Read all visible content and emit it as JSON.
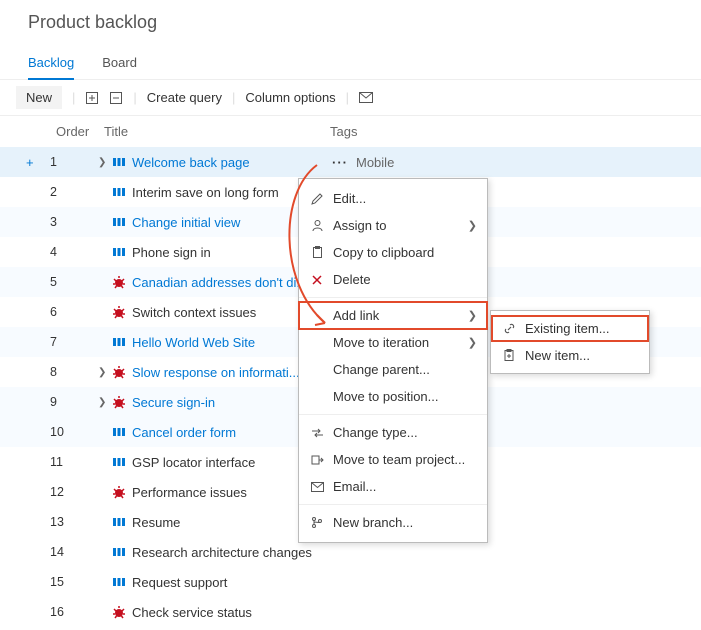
{
  "page_title": "Product backlog",
  "tabs": {
    "backlog": "Backlog",
    "board": "Board"
  },
  "toolbar": {
    "new": "New",
    "create_query": "Create query",
    "column_options": "Column options"
  },
  "columns": {
    "order": "Order",
    "title": "Title",
    "tags": "Tags"
  },
  "items": [
    {
      "order": 1,
      "type": "pbi",
      "title": "Welcome back page",
      "link": true,
      "tag": "Mobile",
      "expand": true,
      "selected": true,
      "more": true
    },
    {
      "order": 2,
      "type": "pbi",
      "title": "Interim save on long form"
    },
    {
      "order": 3,
      "type": "pbi",
      "title": "Change initial view",
      "link": true,
      "alt": true
    },
    {
      "order": 4,
      "type": "pbi",
      "title": "Phone sign in"
    },
    {
      "order": 5,
      "type": "bug",
      "title": "Canadian addresses don't di...",
      "link": true,
      "alt": true
    },
    {
      "order": 6,
      "type": "bug",
      "title": "Switch context issues"
    },
    {
      "order": 7,
      "type": "pbi",
      "title": "Hello World Web Site",
      "link": true,
      "alt": true
    },
    {
      "order": 8,
      "type": "bug",
      "title": "Slow response on informati...",
      "link": true,
      "expand": true
    },
    {
      "order": 9,
      "type": "bug",
      "title": "Secure sign-in",
      "link": true,
      "expand": true,
      "alt": true
    },
    {
      "order": 10,
      "type": "pbi",
      "title": "Cancel order form",
      "link": true,
      "alt": true
    },
    {
      "order": 11,
      "type": "pbi",
      "title": "GSP locator interface"
    },
    {
      "order": 12,
      "type": "bug",
      "title": "Performance issues"
    },
    {
      "order": 13,
      "type": "pbi",
      "title": "Resume"
    },
    {
      "order": 14,
      "type": "pbi",
      "title": "Research architecture changes"
    },
    {
      "order": 15,
      "type": "pbi",
      "title": "Request support"
    },
    {
      "order": 16,
      "type": "bug",
      "title": "Check service status"
    }
  ],
  "menu": {
    "edit": "Edit...",
    "assign_to": "Assign to",
    "copy": "Copy to clipboard",
    "delete": "Delete",
    "add_link": "Add link",
    "move_iteration": "Move to iteration",
    "change_parent": "Change parent...",
    "move_position": "Move to position...",
    "change_type": "Change type...",
    "move_team_project": "Move to team project...",
    "email": "Email...",
    "new_branch": "New branch..."
  },
  "submenu": {
    "existing_item": "Existing item...",
    "new_item": "New item..."
  }
}
